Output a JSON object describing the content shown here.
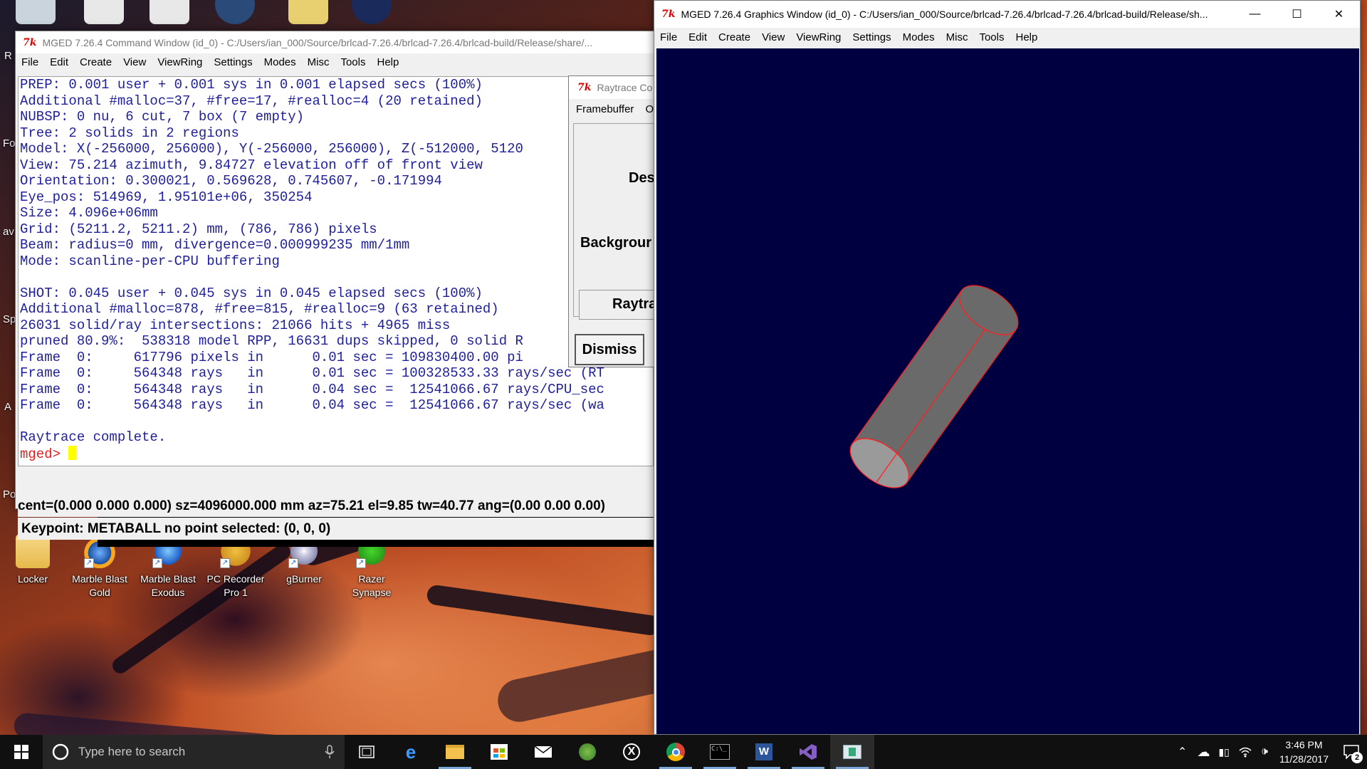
{
  "desktop": {
    "top_icons": [
      "recycle-bin",
      "app",
      "app",
      "settings",
      "notes",
      "media"
    ],
    "icons": [
      {
        "label": "Locker",
        "icon": "folder-icon",
        "color": "#f0c75a"
      },
      {
        "label": "Marble Blast Gold",
        "icon": "marble-blast-gold-icon",
        "color": "#f2a51c"
      },
      {
        "label": "Marble Blast Exodus",
        "icon": "marble-blast-exodus-icon",
        "color": "#2a7de0"
      },
      {
        "label": "PC Recorder Pro 1",
        "icon": "pc-recorder-icon",
        "color": "#e8b23a"
      },
      {
        "label": "gBurner",
        "icon": "gburner-icon",
        "color": "#d0d0e0"
      },
      {
        "label": "Razer Synapse",
        "icon": "razer-synapse-icon",
        "color": "#44d62c"
      }
    ],
    "side_letters": [
      "R",
      "Fo",
      "av",
      "Sp",
      "A",
      "Po"
    ]
  },
  "command_window": {
    "title": "MGED 7.26.4 Command Window (id_0) - C:/Users/ian_000/Source/brlcad-7.26.4/brlcad-7.26.4/brlcad-build/Release/share/...",
    "menu": [
      "File",
      "Edit",
      "Create",
      "View",
      "ViewRing",
      "Settings",
      "Modes",
      "Misc",
      "Tools",
      "Help"
    ],
    "console_lines": [
      "PREP: 0.001 user + 0.001 sys in 0.001 elapsed secs (100%)",
      "Additional #malloc=37, #free=17, #realloc=4 (20 retained)",
      "NUBSP: 0 nu, 6 cut, 7 box (7 empty)",
      "Tree: 2 solids in 2 regions",
      "Model: X(-256000, 256000), Y(-256000, 256000), Z(-512000, 5120",
      "View: 75.214 azimuth, 9.84727 elevation off of front view",
      "Orientation: 0.300021, 0.569628, 0.745607, -0.171994",
      "Eye_pos: 514969, 1.95101e+06, 350254",
      "Size: 4.096e+06mm",
      "Grid: (5211.2, 5211.2) mm, (786, 786) pixels",
      "Beam: radius=0 mm, divergence=0.000999235 mm/1mm",
      "Mode: scanline-per-CPU buffering",
      "",
      "SHOT: 0.045 user + 0.045 sys in 0.045 elapsed secs (100%)",
      "Additional #malloc=878, #free=815, #realloc=9 (63 retained)",
      "26031 solid/ray intersections: 21066 hits + 4965 miss",
      "pruned 80.9%:  538318 model RPP, 16631 dups skipped, 0 solid R",
      "Frame  0:     617796 pixels in      0.01 sec = 109830400.00 pi",
      "Frame  0:     564348 rays   in      0.01 sec = 100328533.33 rays/sec (RT",
      "Frame  0:     564348 rays   in      0.04 sec =  12541066.67 rays/CPU_sec",
      "Frame  0:     564348 rays   in      0.04 sec =  12541066.67 rays/sec (wa",
      "",
      "Raytrace complete."
    ],
    "prompt": "mged>",
    "status_line_1": "cent=(0.000 0.000 0.000) sz=4096000.000  mm  az=75.21  el=9.85  tw=40.77  ang=(0.00 0.00 0.00)",
    "status_line_2": "Keypoint: METABALL no point selected: (0, 0, 0)"
  },
  "raytrace_dialog": {
    "title": "Raytrace Co",
    "menu": [
      "Framebuffer",
      "O"
    ],
    "label_destination": "Des",
    "label_background": "Backgrour",
    "raytrace_button": "Raytra",
    "dismiss_button": "Dismiss"
  },
  "graphics_window": {
    "title": "MGED 7.26.4 Graphics Window (id_0) - C:/Users/ian_000/Source/brlcad-7.26.4/brlcad-7.26.4/brlcad-build/Release/sh...",
    "menu": [
      "File",
      "Edit",
      "Create",
      "View",
      "ViewRing",
      "Settings",
      "Modes",
      "Misc",
      "Tools",
      "Help"
    ],
    "background_color": "#000040",
    "wireframe_color": "#ff2020"
  },
  "taskbar": {
    "search_placeholder": "Type here to search",
    "apps": [
      "task-view",
      "edge",
      "file-explorer",
      "store",
      "mail",
      "tree-app",
      "xbox",
      "chrome",
      "cmd",
      "word",
      "visual-studio",
      "mged"
    ],
    "time": "3:46 PM",
    "date": "11/28/2017",
    "notification_count": "2"
  }
}
